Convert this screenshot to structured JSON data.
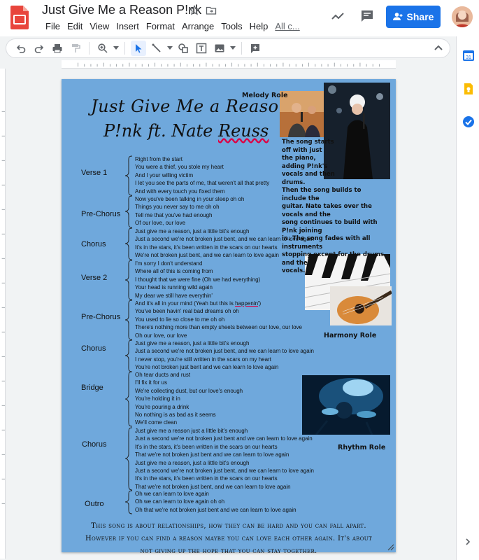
{
  "app": {
    "title": "Just Give Me a Reason P!nk",
    "menu": [
      "File",
      "Edit",
      "View",
      "Insert",
      "Format",
      "Arrange",
      "Tools",
      "Help"
    ],
    "all_changes": "All c...",
    "share_label": "Share",
    "colors": {
      "accent": "#1a73e8",
      "slide_bg": "#6fa8dc",
      "logo": "#e8453c"
    }
  },
  "toolbar": {
    "icons": [
      "undo-icon",
      "redo-icon",
      "print-icon",
      "paint-format-icon",
      "zoom-icon",
      "select-icon",
      "line-icon",
      "shape-icon",
      "text-box-icon",
      "image-icon",
      "comment-icon"
    ]
  },
  "slide": {
    "title": "Just Give Me a Reason",
    "artist": "P!nk ft. Nate ",
    "artist_underlined": "Reuss",
    "melody_role": "Melody Role",
    "harmony_role": "Harmony Role",
    "rhythm_role": "Rhythm Role",
    "notes_top": [
      "The song starts",
      "off with just",
      "the piano,",
      "adding P!nk's",
      "vocals and then",
      "drums."
    ],
    "notes_bottom": [
      "Then the song builds to include the",
      "guitar. Nate takes over the vocals and the",
      "song continues to build with P!nk joining",
      "in. The song fades with all instruments",
      "stopping except for the drums and the",
      "vocals."
    ],
    "sections": [
      {
        "label": "Verse 1",
        "lines": [
          "Right from the start",
          "You were a thief, you stole my heart",
          "And I your willing victim",
          "I let you see the parts of me, that weren't all that pretty",
          "And with every touch you fixed them"
        ]
      },
      {
        "label": "Pre-Chorus",
        "lines": [
          "Now you've been talking in your sleep oh oh",
          "Things you never say to me oh oh",
          "Tell me that you've had enough",
          "Of our love, our love"
        ]
      },
      {
        "label": "Chorus",
        "lines": [
          "Just give me a reason, just a little bit's enough",
          "Just a second we're not broken just bent, and we can learn to love again",
          "It's in the stars, it's been written in the scars on our hearts",
          "We're not broken just bent, and we can learn to love again"
        ]
      },
      {
        "label": "Verse 2",
        "lines": [
          "I'm sorry I don't understand",
          "Where all of this is coming from",
          "I thought that we were fine (Oh we had everything)",
          "Your head is running wild again",
          "My dear we still have everythin'"
        ]
      },
      {
        "label": "Pre-Chorus",
        "lines": [
          "And it's all in your mind (Yeah but this is ",
          "You've been havin' real bad dreams oh oh",
          "You used to lie so close to me oh oh",
          "There's nothing more than empty sheets between our love, our love",
          "Oh our love, our love"
        ],
        "underlined_word": "happenin"
      },
      {
        "label": "Chorus",
        "lines": [
          "Just give me a reason, just a little bit's enough",
          "Just a second we're not broken just bent, and we can learn to love again",
          "I never stop, you're still written in the scars on my heart",
          "You're not broken just bent and we can learn to love again"
        ]
      },
      {
        "label": "Bridge",
        "lines": [
          "Oh tear ducts and rust",
          "I'll fix it for us",
          "We're collecting dust, but our love's enough",
          "You're holding it in",
          "You're pouring a drink",
          "No nothing is as bad as it seems",
          "We'll come clean"
        ]
      },
      {
        "label": "Chorus",
        "lines": [
          "Just give me a reason just a little bit's enough",
          "Just a second we're not broken just bent and we can learn to love again",
          "It's in the stars, it's been written in the scars on our hearts",
          "That we're not broken just bent and we can learn to love again",
          "Just give me a reason, just a little bit's enough",
          "Just a second we're not broken just bent, and we can learn to love again",
          "It's in the stars, it's been written in the scars on our hearts",
          "That we're not broken just bent, and we can learn to love again"
        ]
      },
      {
        "label": "Outro",
        "lines": [
          "Oh we can learn to love again",
          "Oh we can learn to love again oh oh",
          "Oh that we're not broken just bent and we can learn to love again"
        ]
      }
    ],
    "summary": "This song is about relationships, how they can be hard and you can fall apart. However if you can find a reason maybe you can love each other again. It's about not giving up the hope that you can stay together."
  }
}
